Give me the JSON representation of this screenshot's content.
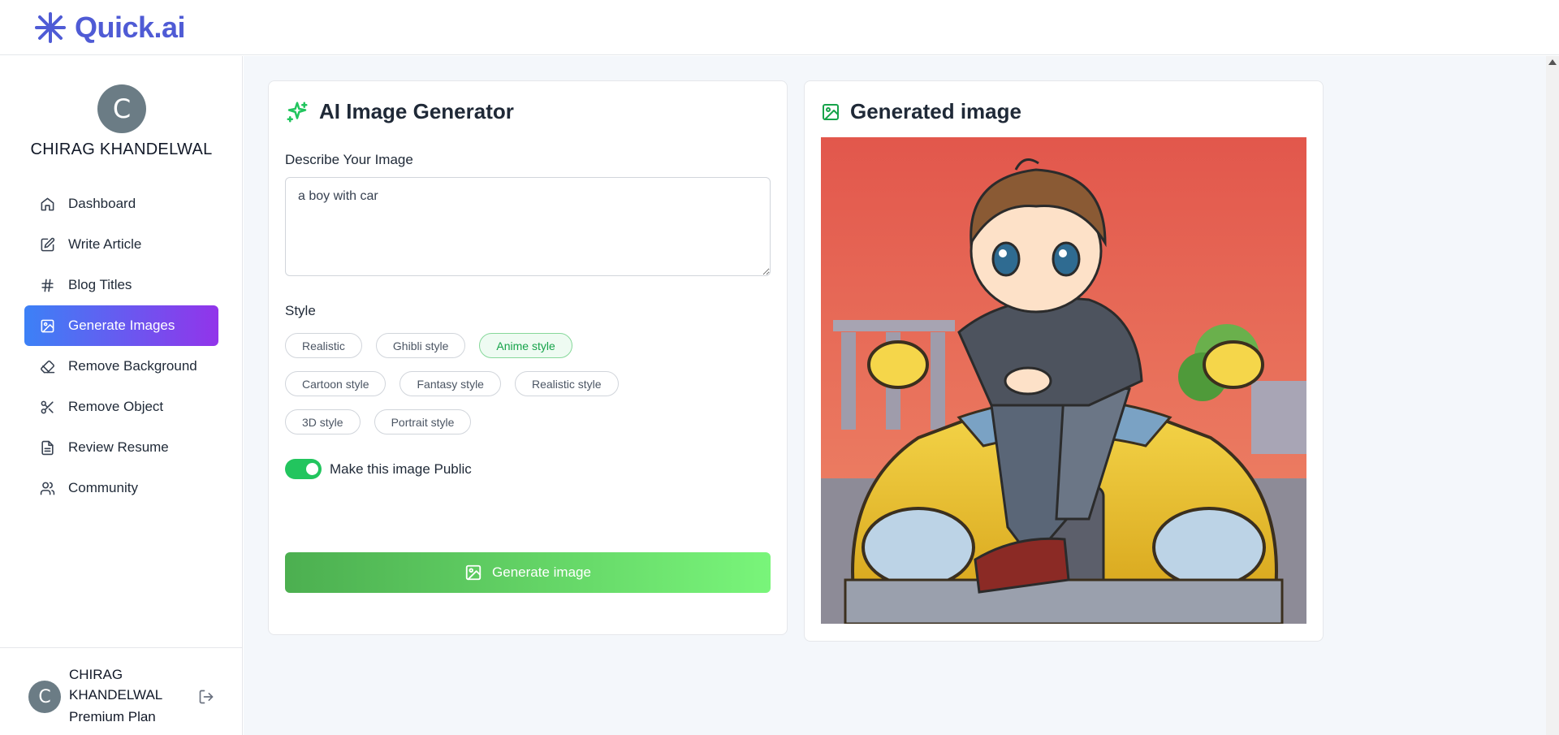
{
  "header": {
    "logo_text": "Quick.ai",
    "brand_color": "#4f5bd5"
  },
  "sidebar": {
    "avatar_initial": "C",
    "user_name": "CHIRAG KHANDELWAL",
    "items": [
      {
        "label": "Dashboard",
        "icon": "home-icon"
      },
      {
        "label": "Write Article",
        "icon": "edit-icon"
      },
      {
        "label": "Blog Titles",
        "icon": "hash-icon"
      },
      {
        "label": "Generate Images",
        "icon": "image-icon",
        "active": true
      },
      {
        "label": "Remove Background",
        "icon": "eraser-icon"
      },
      {
        "label": "Remove Object",
        "icon": "scissors-icon"
      },
      {
        "label": "Review Resume",
        "icon": "file-text-icon"
      },
      {
        "label": "Community",
        "icon": "users-icon"
      }
    ],
    "footer": {
      "avatar_initial": "C",
      "name": "CHIRAG KHANDELWAL",
      "plan": "Premium Plan"
    },
    "active_gradient": [
      "#3c81f6",
      "#9234ea"
    ]
  },
  "generator": {
    "title": "AI Image Generator",
    "prompt_label": "Describe Your Image",
    "prompt_value": "a boy with car",
    "style_label": "Style",
    "styles": [
      [
        "Realistic",
        "Ghibli style",
        "Anime style"
      ],
      [
        "Cartoon style",
        "Fantasy style",
        "Realistic style"
      ],
      [
        "3D style",
        "Portrait style"
      ]
    ],
    "selected_style": "Anime style",
    "public_toggle_label": "Make this image Public",
    "public_toggle_on": true,
    "generate_button_label": "Generate image",
    "accent_color": "#22c55e"
  },
  "result": {
    "title": "Generated image",
    "image_description_icon": "image-icon"
  }
}
